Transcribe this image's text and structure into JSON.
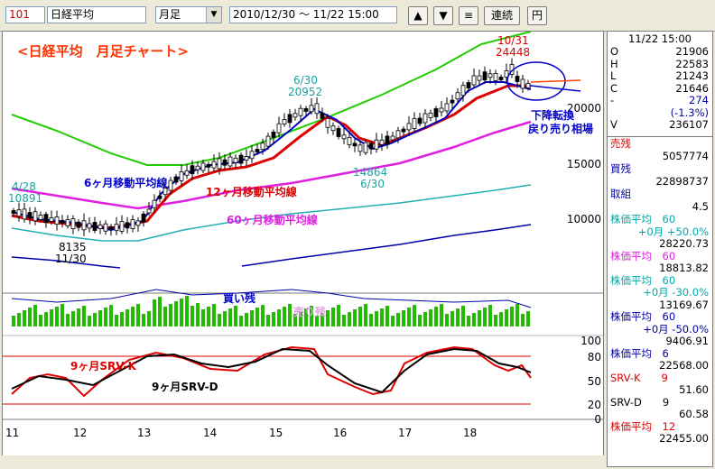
{
  "toolbar": {
    "code": "101",
    "name": "日経平均",
    "period": "月足",
    "range": "2010/12/30 ～ 11/22 15:00",
    "btn_up": "▲",
    "btn_down": "▼",
    "btn_menu": "≡",
    "btn_renzoku": "連続",
    "btn_yen": "円"
  },
  "chart": {
    "title": "<日経平均　月足チャート>",
    "y_ticks": [
      "20000",
      "15000",
      "10000"
    ],
    "osc_ticks": [
      "100",
      "80",
      "50",
      "20",
      "0"
    ],
    "x_ticks": [
      "11",
      "12",
      "13",
      "14",
      "15",
      "16",
      "17",
      "18"
    ],
    "labels": {
      "ma6": "6ヶ月移動平均線",
      "ma12": "12ヶ月移動平均線",
      "ma60": "60ヶ月移動平均線",
      "kaizan": "買い残",
      "urizan": "売り残",
      "srvk": "9ヶ月SRV-K",
      "srvd": "9ヶ月SRV-D",
      "trend1": "下降転換",
      "trend2": "戻り売り相場",
      "a1_date": "10/31",
      "a1_val": "24448",
      "a2_date": "6/30",
      "a2_val": "20952",
      "a3_val": "14864",
      "a3_date": "6/30",
      "a4_date": "4/28",
      "a4_val": "10891",
      "a5_val": "8135",
      "a5_date": "11/30"
    },
    "colors": {
      "ma6": "#0000cc",
      "ma12": "#dd0000",
      "ma60": "#e020e0",
      "ma_green": "#22cc00",
      "ma_cyan": "#20b0b0",
      "ma_navy": "#0000aa",
      "volume": "#22bb00",
      "srvk": "#dd0000",
      "srvd": "#000000"
    }
  },
  "panel": {
    "datetime": "11/22 15:00",
    "ohlc": [
      {
        "k": "O",
        "v": "21906"
      },
      {
        "k": "H",
        "v": "22583"
      },
      {
        "k": "L",
        "v": "21243"
      },
      {
        "k": "C",
        "v": "21646"
      },
      {
        "k": "-",
        "v": "274"
      },
      {
        "k": "",
        "v": "(-1.3%)"
      },
      {
        "k": "V",
        "v": "236107"
      }
    ],
    "urizan_label": "売残",
    "urizan_value": "5057774",
    "kaizan_label": "買残",
    "kaizan_value": "22898737",
    "torikumi_label": "取組",
    "torikumi_value": "4.5",
    "ma": [
      {
        "name": "株価平均",
        "period": "60",
        "sub": "+0月 +50.0%",
        "value": "28220.73",
        "color": "#00aaaa"
      },
      {
        "name": "株価平均",
        "period": "60",
        "sub": "",
        "value": "18813.82",
        "color": "#e020e0"
      },
      {
        "name": "株価平均",
        "period": "60",
        "sub": "+0月 -30.0%",
        "value": "13169.67",
        "color": "#00aaaa"
      },
      {
        "name": "株価平均",
        "period": "60",
        "sub": "+0月 -50.0%",
        "value": "9406.91",
        "color": "#0000aa"
      },
      {
        "name": "株価平均",
        "period": "6",
        "sub": "",
        "value": "22568.00",
        "color": "#0000aa"
      }
    ],
    "srvk": {
      "name": "SRV-K",
      "period": "9",
      "value": "51.60"
    },
    "srvd": {
      "name": "SRV-D",
      "period": "9",
      "value": "60.58"
    },
    "ma12": {
      "name": "株価平均",
      "period": "12",
      "value": "22455.00"
    }
  }
}
